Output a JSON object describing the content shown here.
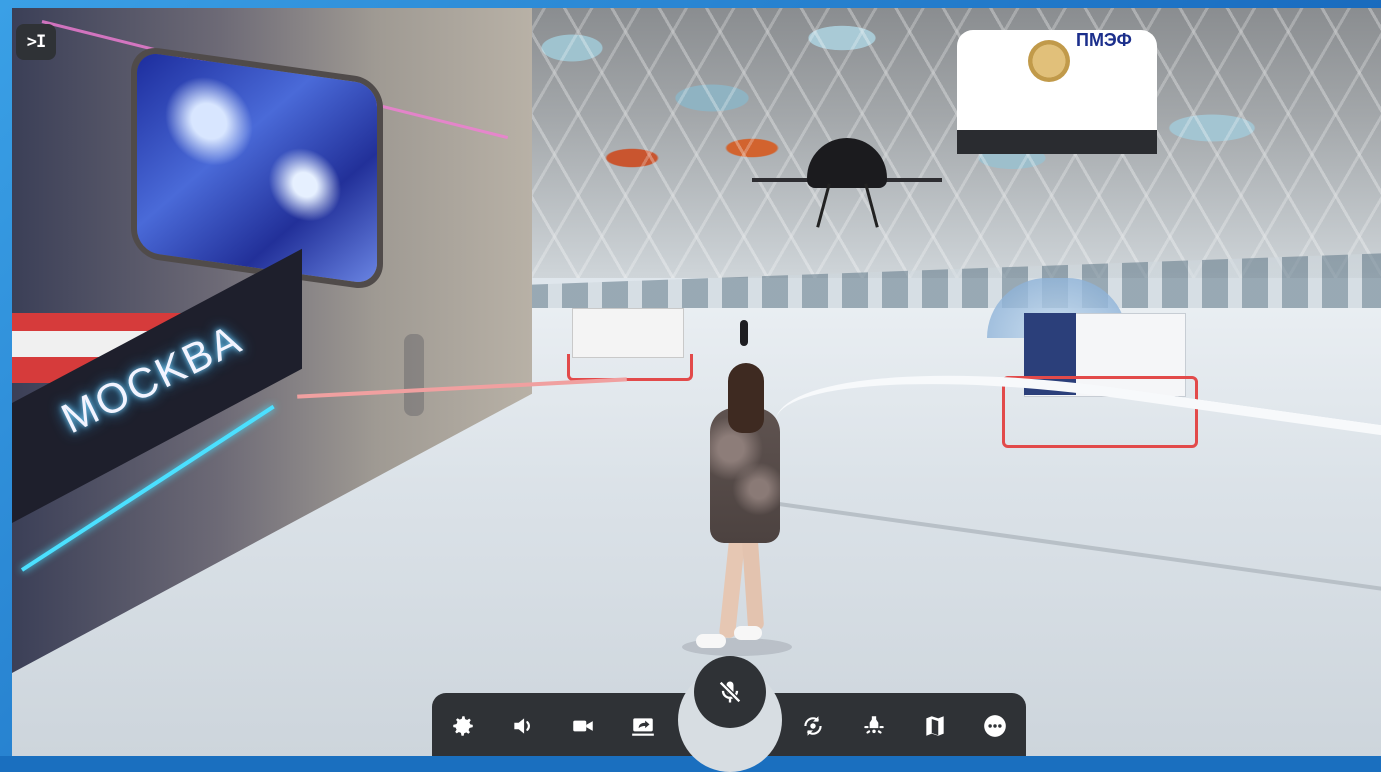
{
  "sidebar_toggle": {
    "label": ">I"
  },
  "scene": {
    "moscow_sign": "MOCKBA",
    "banner": {
      "title": "ПМЭФ"
    }
  },
  "toolbar": {
    "buttons": [
      {
        "name": "settings",
        "icon": "gear-icon"
      },
      {
        "name": "volume",
        "icon": "speaker-icon"
      },
      {
        "name": "camera",
        "icon": "video-camera-icon"
      },
      {
        "name": "screen-share",
        "icon": "screen-share-icon"
      },
      {
        "name": "microphone",
        "icon": "microphone-muted-icon",
        "state": "muted"
      },
      {
        "name": "rotate-camera",
        "icon": "rotate-view-icon"
      },
      {
        "name": "lights",
        "icon": "light-icon"
      },
      {
        "name": "map",
        "icon": "map-icon"
      },
      {
        "name": "more",
        "icon": "more-dots-icon"
      }
    ]
  },
  "colors": {
    "toolbar_bg": "#2f3236",
    "frame_border": "#1b6fc2",
    "icon": "#ffffff"
  }
}
